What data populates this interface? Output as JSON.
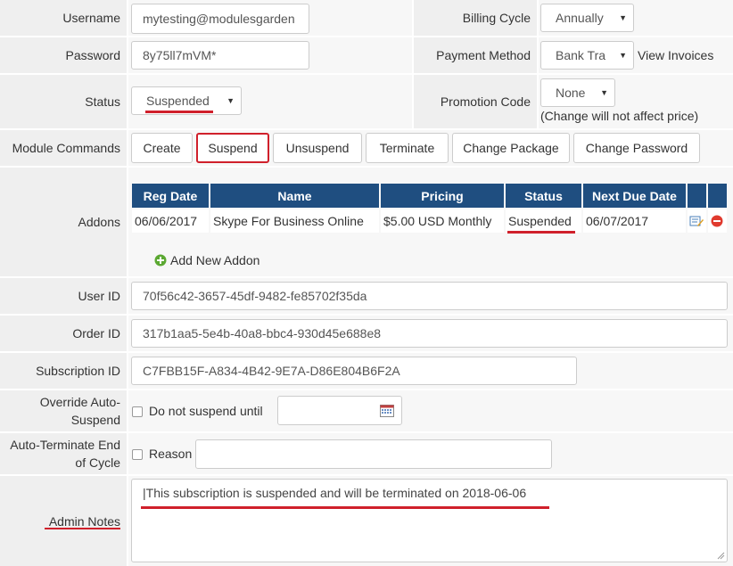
{
  "labels": {
    "username": "Username",
    "password": "Password",
    "status": "Status",
    "module_commands": "Module Commands",
    "addons": "Addons",
    "user_id": "User ID",
    "order_id": "Order ID",
    "subscription_id": "Subscription ID",
    "override_auto_suspend": "Override Auto-Suspend",
    "auto_terminate": "Auto-Terminate End of Cycle",
    "admin_notes": "Admin Notes",
    "billing_cycle": "Billing Cycle",
    "payment_method": "Payment Method",
    "promotion_code": "Promotion Code"
  },
  "fields": {
    "username": "mytesting@modulesgarden",
    "password": "8y75ll7mVM*",
    "status": "Suspended",
    "billing_cycle": "Annually",
    "payment_method": "Bank Tra",
    "promotion_code": "None",
    "user_id": "70f56c42-3657-45df-9482-fe85702f35da",
    "order_id": "317b1aa5-5e4b-40a8-bbc4-930d45e688e8",
    "subscription_id": "C7FBB15F-A834-4B42-9E7A-D86E804B6F2A",
    "admin_notes": "|This subscription is suspended and will be terminated on 2018-06-06"
  },
  "links": {
    "view_invoices": "View Invoices",
    "add_new_addon": "Add New Addon"
  },
  "notes": {
    "promotion_note": "(Change will not affect price)",
    "do_not_suspend_until": "Do not suspend until",
    "reason": "Reason"
  },
  "module_commands": [
    "Create",
    "Suspend",
    "Unsuspend",
    "Terminate",
    "Change Package",
    "Change Password"
  ],
  "addons_table": {
    "headers": [
      "Reg Date",
      "Name",
      "Pricing",
      "Status",
      "Next Due Date"
    ],
    "rows": [
      {
        "reg_date": "06/06/2017",
        "name": "Skype For Business Online",
        "pricing": "$5.00 USD Monthly",
        "status": "Suspended",
        "next_due": "06/07/2017"
      }
    ]
  },
  "colors": {
    "highlight": "#d0202b",
    "table_header": "#1f4e80",
    "label_bg": "#efefef"
  }
}
